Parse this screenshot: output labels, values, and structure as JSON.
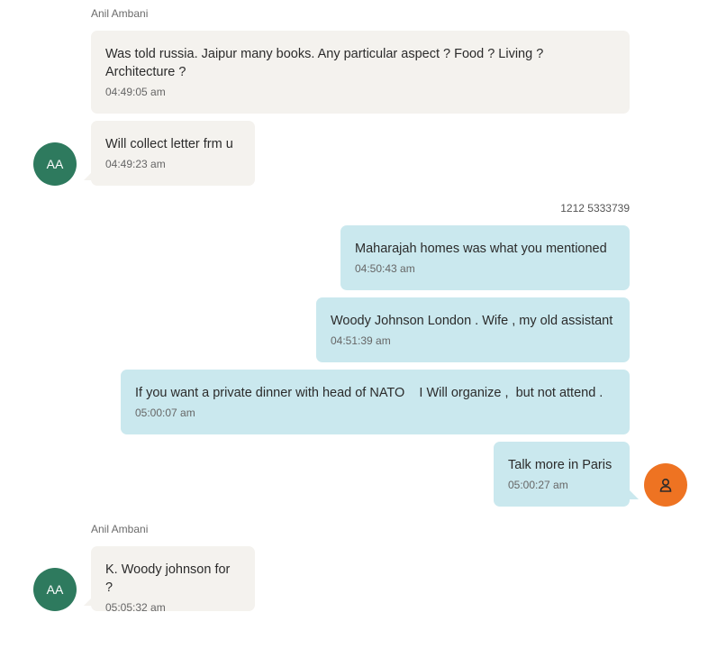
{
  "groups": [
    {
      "sender": "Anil Ambani",
      "avatar_initials": "AA",
      "messages": [
        {
          "text": "Was told russia. Jaipur many books. Any particular aspect ? Food ? Living ? Architecture ?",
          "time": "04:49:05 am"
        },
        {
          "text": "Will collect letter frm u",
          "time": "04:49:23 am"
        }
      ]
    },
    {
      "sender": "1212 5333739",
      "avatar_icon": "person-icon",
      "messages": [
        {
          "text": "Maharajah homes was what you mentioned",
          "time": "04:50:43 am"
        },
        {
          "text": "Woody Johnson London . Wife , my old assistant",
          "time": "04:51:39 am"
        },
        {
          "text": "If you want a private dinner with head of NATO    I Will organize ,  but not attend .",
          "time": "05:00:07 am"
        },
        {
          "text": "Talk more in Paris",
          "time": "05:00:27 am"
        }
      ]
    },
    {
      "sender": "Anil Ambani",
      "avatar_initials": "AA",
      "messages": [
        {
          "text": "K. Woody johnson for ?",
          "time": "05:05:32 am"
        }
      ]
    }
  ],
  "colors": {
    "incoming_bubble": "#f4f2ee",
    "outgoing_bubble": "#cae8ee",
    "contact_avatar": "#2e7a5e",
    "self_avatar": "#ee7322"
  }
}
